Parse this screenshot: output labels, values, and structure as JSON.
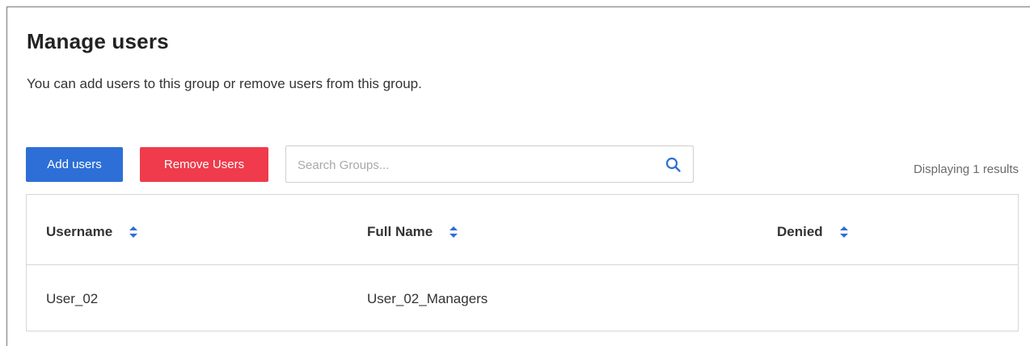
{
  "page": {
    "title": "Manage users",
    "description": "You can add users to this group or remove users from this group."
  },
  "toolbar": {
    "add_label": "Add users",
    "remove_label": "Remove Users",
    "search_placeholder": "Search Groups...",
    "search_value": "",
    "results_text": "Displaying 1 results"
  },
  "colors": {
    "add_button": "#2d6fd6",
    "remove_button": "#ef3b4b",
    "sort_icon": "#2d6fd6"
  },
  "table": {
    "columns": [
      {
        "label": "Username",
        "icon": "sort-icon"
      },
      {
        "label": "Full Name",
        "icon": "sort-icon"
      },
      {
        "label": "Denied",
        "icon": "sort-icon"
      }
    ],
    "rows": [
      {
        "username": "User_02",
        "full_name": "User_02_Managers",
        "denied": ""
      }
    ]
  }
}
